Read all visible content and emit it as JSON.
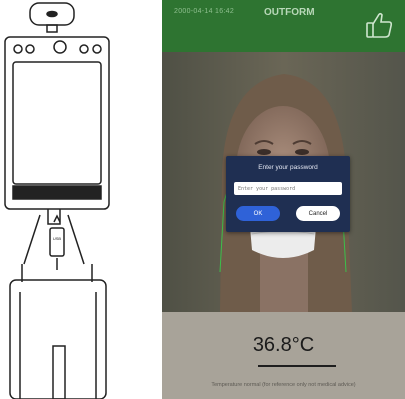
{
  "header": {
    "datetime": "2000-04-14  16:42",
    "brand": "OUTFORM",
    "like_icon": "thumbs-up-icon"
  },
  "dialog": {
    "title": "Enter your password",
    "password_placeholder": "Enter your password",
    "ok_label": "OK",
    "cancel_label": "Cancel"
  },
  "reading": {
    "temperature": "36.8°C",
    "note": "Temperature normal (for reference only not medical advice)"
  },
  "device": {
    "usb_label": "USB"
  },
  "colors": {
    "topbar": "#2e7431",
    "dialog_bg": "#1f2f52",
    "ok_button": "#2f62d8",
    "face_outline": "#3cc04a"
  }
}
